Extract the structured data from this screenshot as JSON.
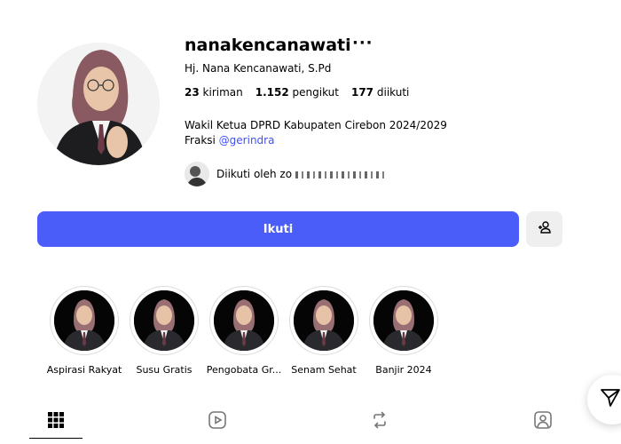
{
  "profile": {
    "username": "nanakencanawati",
    "more_label": "···",
    "full_name": "Hj. Nana Kencanawati, S.Pd",
    "stats": {
      "posts_count": "23",
      "posts_label": "kiriman",
      "followers_count": "1.152",
      "followers_label": "pengikut",
      "following_count": "177",
      "following_label": "diikuti"
    },
    "bio_line1": "Wakil Ketua DPRD Kabupaten Cirebon 2024/2029",
    "bio_line2_prefix": "Fraksi ",
    "bio_line2_tag": "@gerindra",
    "followed_by": "Diikuti oleh zo"
  },
  "actions": {
    "follow_label": "Ikuti"
  },
  "highlights": [
    {
      "label": "Aspirasi Rakyat"
    },
    {
      "label": "Susu Gratis"
    },
    {
      "label": "Pengobata Gr..."
    },
    {
      "label": "Senam Sehat"
    },
    {
      "label": "Banjir 2024"
    }
  ],
  "icons": {
    "avatar": "profile-photo",
    "add_person": "person-add-icon",
    "grid": "grid-icon",
    "reels": "reels-icon",
    "reposts": "repost-icon",
    "tagged": "tagged-icon",
    "send": "send-icon"
  },
  "colors": {
    "accent": "#4a5df9",
    "link": "#4150f7",
    "secondary_button": "#efefef"
  }
}
